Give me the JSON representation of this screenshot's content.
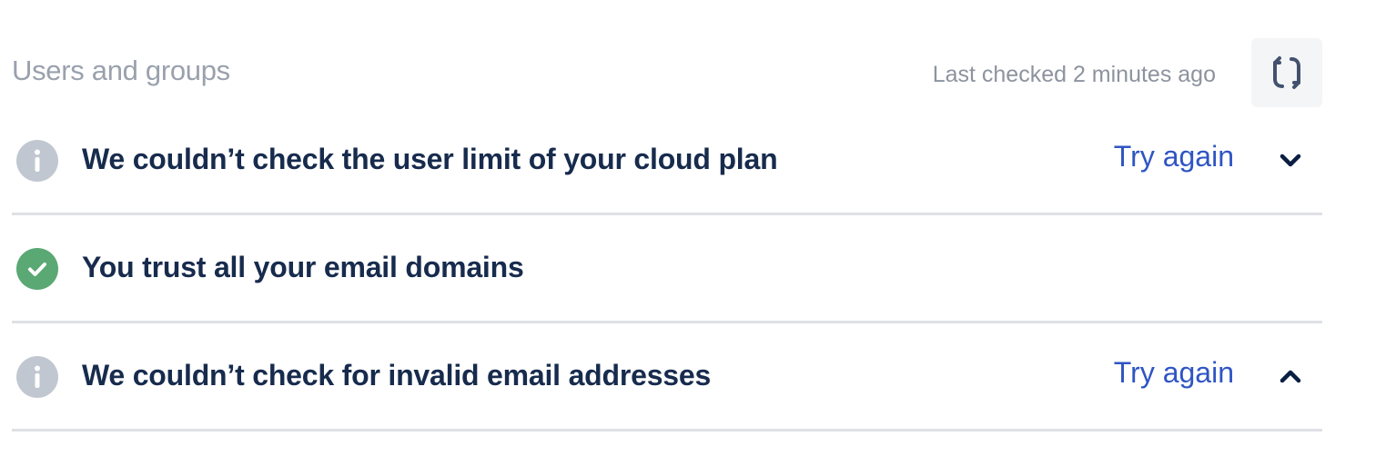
{
  "header": {
    "title": "Users and groups",
    "last_checked": "Last checked 2 minutes ago",
    "refresh_icon": "refresh-icon"
  },
  "checks": [
    {
      "status": "info",
      "status_color": "#c1c7d0",
      "text": "We couldn’t check the user limit of your cloud plan",
      "action_label": "Try again",
      "expanded": false
    },
    {
      "status": "success",
      "status_color": "#5aa873",
      "text": "You trust all your email domains"
    },
    {
      "status": "info",
      "status_color": "#c1c7d0",
      "text": "We couldn’t check for invalid email addresses",
      "action_label": "Try again",
      "expanded": true
    }
  ],
  "colors": {
    "title": "#9aa1ad",
    "text": "#172b4d",
    "link": "#2f55c4",
    "divider": "#dfe1e6",
    "refresh_bg": "#f4f5f7"
  }
}
